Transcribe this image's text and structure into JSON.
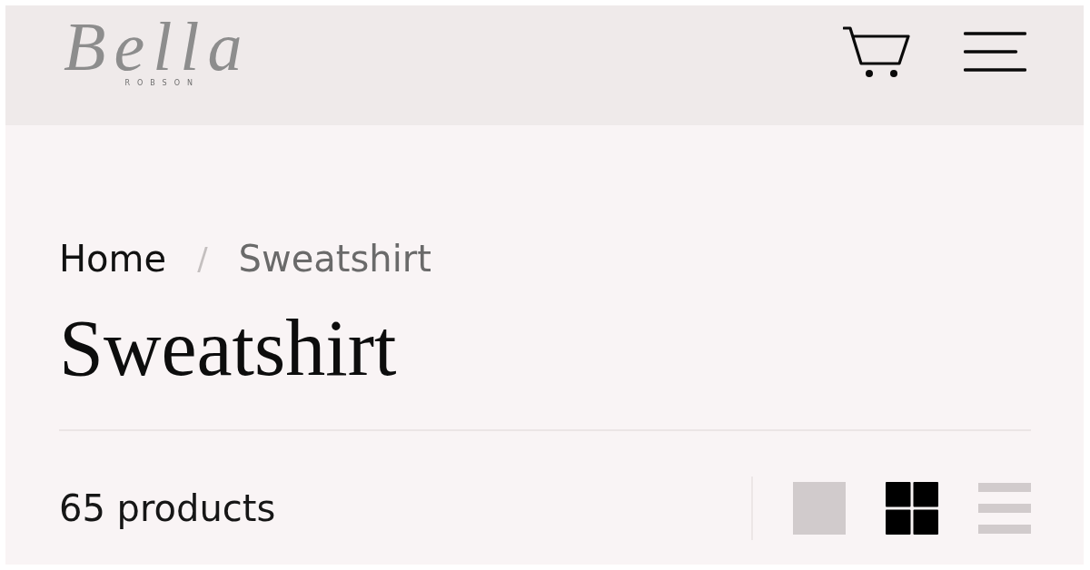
{
  "header": {
    "logo": {
      "script": "Bella",
      "subtitle": "ROBSON"
    }
  },
  "breadcrumb": {
    "separator": "/",
    "items": [
      {
        "label": "Home",
        "current": false
      },
      {
        "label": "Sweatshirt",
        "current": true
      }
    ]
  },
  "title": "Sweatshirt",
  "toolbar": {
    "product_count": "65 products",
    "view_options": [
      {
        "kind": "single",
        "selected": false
      },
      {
        "kind": "grid",
        "selected": true
      },
      {
        "kind": "list",
        "selected": false
      }
    ]
  }
}
